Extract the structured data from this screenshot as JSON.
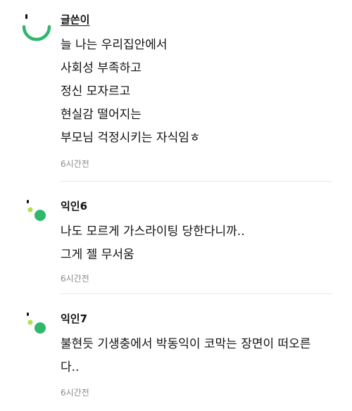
{
  "comments": [
    {
      "author": "글쓴이",
      "author_is_op": true,
      "lines": [
        "늘 나는 우리집안에서",
        "사회성 부족하고",
        "정신 모자르고",
        "현실감 떨어지는",
        "부모님 걱정시키는 자식임ㅎ"
      ],
      "time": "6시간전"
    },
    {
      "author": "익인6",
      "lines": [
        "나도 모르게 가스라이팅 당한다니까..",
        "그게 젤 무서움"
      ],
      "time": "6시간전"
    },
    {
      "author": "익인7",
      "lines": [
        "불현듯 기생충에서 박동익이 코막는 장면이 떠오른",
        "다.."
      ],
      "time": "6시간전"
    }
  ],
  "colors": {
    "avatar_green": "#2fb86a",
    "avatar_light_green": "#b8e04a",
    "time_gray": "#8a8a8a"
  }
}
